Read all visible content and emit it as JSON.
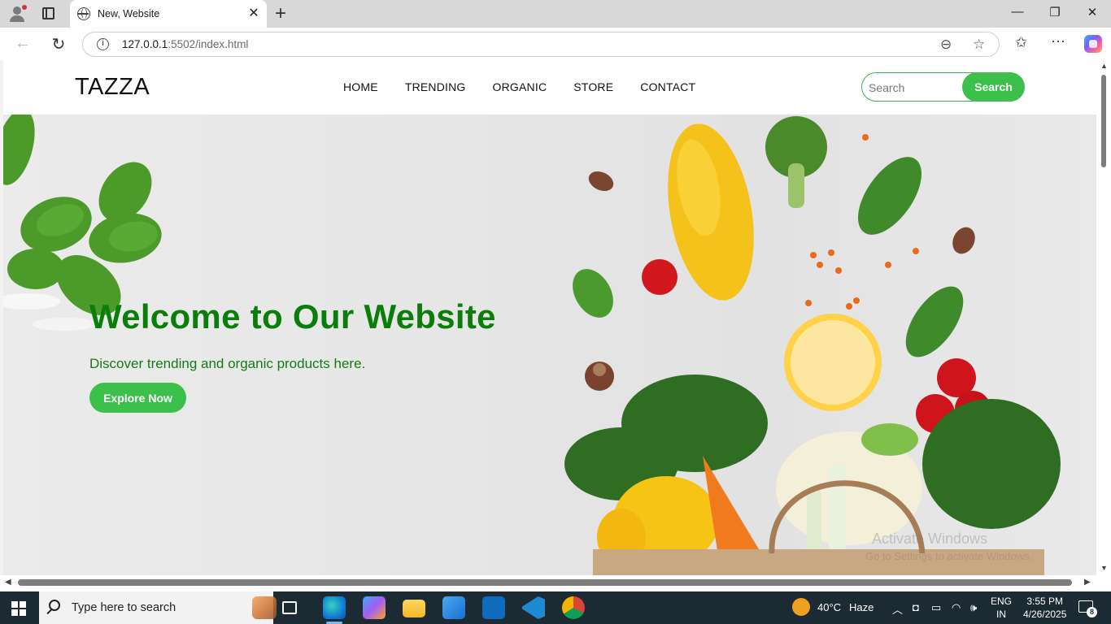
{
  "browser": {
    "tab_title": "New, Website",
    "url_host": "127.0.0.1",
    "url_rest": ":5502/index.html"
  },
  "site": {
    "logo": "TAZZA",
    "nav": [
      "HOME",
      "TRENDING",
      "ORGANIC",
      "STORE",
      "CONTACT"
    ],
    "search_placeholder": "Search",
    "search_button": "Search",
    "hero": {
      "title": "Welcome to Our Website",
      "subtitle": "Discover trending and organic products here.",
      "button": "Explore Now"
    },
    "watermark": "Activate Windows",
    "watermark_sub": "Go to Settings to activate Windows."
  },
  "taskbar": {
    "search_placeholder": "Type here to search",
    "weather_temp": "40°C",
    "weather_desc": "Haze",
    "lang_top": "ENG",
    "lang_bottom": "IN",
    "time": "3:55 PM",
    "date": "4/26/2025",
    "notification_count": "8"
  },
  "colors": {
    "accent_green": "#3bc04c",
    "title_green": "#0a7d0a"
  }
}
